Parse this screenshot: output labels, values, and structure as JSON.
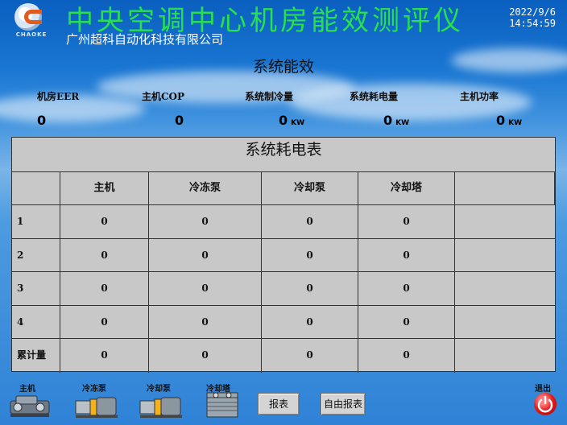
{
  "header": {
    "title": "中央空调中心机房能效测评仪",
    "company": "广州超科自动化科技有限公司",
    "logo_text": "CHAOKE",
    "date": "2022/9/6",
    "time": "14:54:59"
  },
  "efficiency": {
    "title": "系统能效",
    "metrics": [
      {
        "label": "机房EER",
        "value": "0",
        "unit": ""
      },
      {
        "label": "主机COP",
        "value": "0",
        "unit": ""
      },
      {
        "label": "系统制冷量",
        "value": "0",
        "unit": "KW"
      },
      {
        "label": "系统耗电量",
        "value": "0",
        "unit": "KW"
      },
      {
        "label": "主机功率",
        "value": "0",
        "unit": "KW"
      }
    ]
  },
  "power_table": {
    "title": "系统耗电表",
    "headers": [
      "",
      "主机",
      "冷冻泵",
      "冷却泵",
      "冷却塔",
      ""
    ],
    "rows": [
      {
        "label": "1",
        "values": [
          "0",
          "0",
          "0",
          "0",
          ""
        ]
      },
      {
        "label": "2",
        "values": [
          "0",
          "0",
          "0",
          "0",
          ""
        ]
      },
      {
        "label": "3",
        "values": [
          "0",
          "0",
          "0",
          "0",
          ""
        ]
      },
      {
        "label": "4",
        "values": [
          "0",
          "0",
          "0",
          "0",
          ""
        ]
      },
      {
        "label": "累计量",
        "values": [
          "0",
          "0",
          "0",
          "0",
          ""
        ]
      }
    ]
  },
  "bottom_bar": {
    "devices": [
      {
        "label": "主机",
        "icon": "chiller-icon"
      },
      {
        "label": "冷冻泵",
        "icon": "chilled-pump-icon"
      },
      {
        "label": "冷却泵",
        "icon": "cooling-pump-icon"
      },
      {
        "label": "冷却塔",
        "icon": "cooling-tower-icon"
      }
    ],
    "report_label": "报表",
    "custom_report_label": "自由报表",
    "exit_label": "退出",
    "exit_icon": "power-icon",
    "exit_color": "#e21b1b"
  },
  "colors": {
    "title_green": "#28e04e",
    "table_bg": "#c8c8c8"
  }
}
